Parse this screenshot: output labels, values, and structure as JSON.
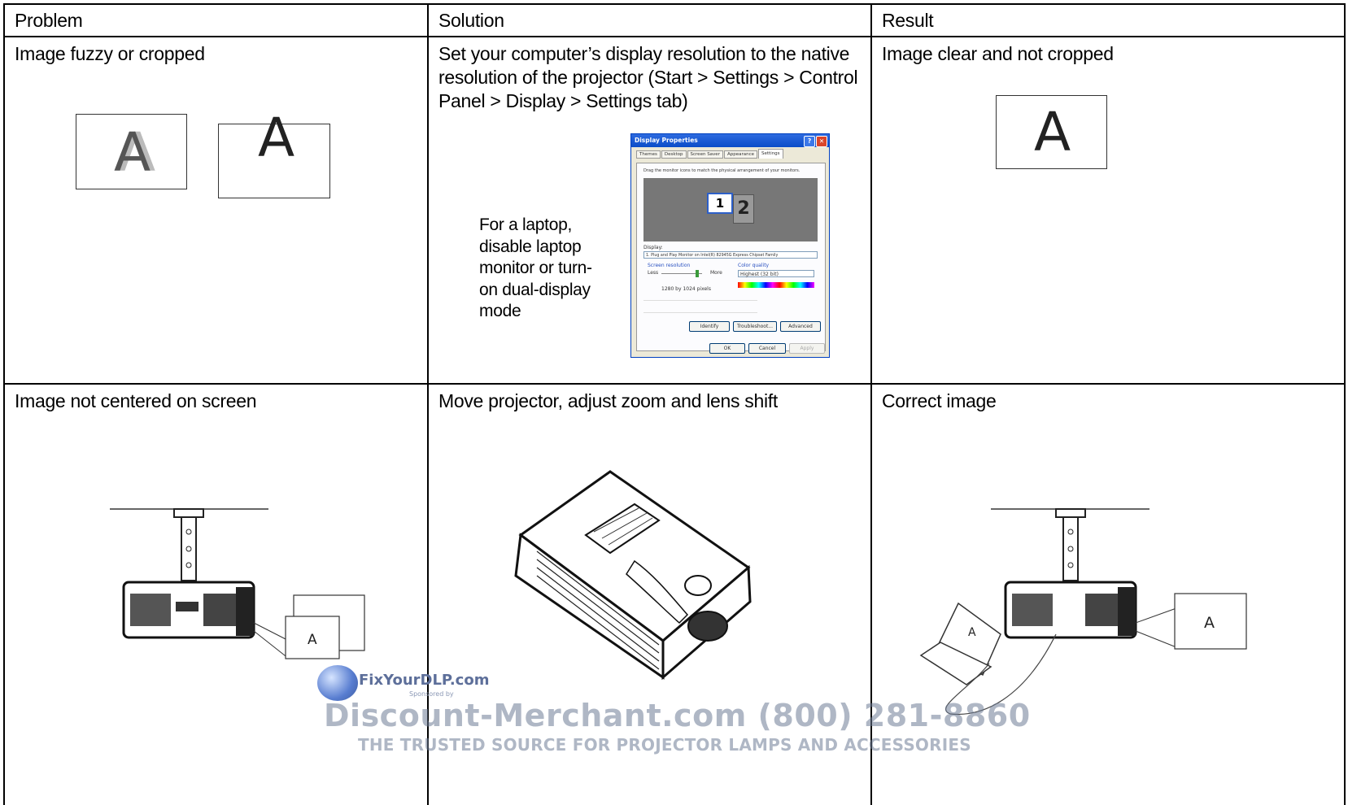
{
  "headers": {
    "problem": "Problem",
    "solution": "Solution",
    "result": "Result"
  },
  "row1": {
    "problem": "Image fuzzy or cropped",
    "solution_lines": [
      "Set your computer’s display resolution to the native",
      "resolution of the projector (Start > Settings > Control",
      "Panel > Display > Settings tab)"
    ],
    "result": "Image clear and not cropped",
    "laptop_note_lines": [
      "For a laptop,",
      "disable laptop",
      "monitor or turn-",
      "on dual-display",
      "mode"
    ],
    "letter": "A"
  },
  "dialog": {
    "title": "Display Properties",
    "tabs": [
      "Themes",
      "Desktop",
      "Screen Saver",
      "Appearance",
      "Settings"
    ],
    "instruction": "Drag the monitor icons to match the physical arrangement of your monitors.",
    "monitor_1": "1",
    "monitor_2": "2",
    "display_label": "Display:",
    "display_value": "1. Plug and Play Monitor on Intel(R) 82945G Express Chipset Family",
    "resolution_label": "Screen resolution",
    "less": "Less",
    "more": "More",
    "resolution_value": "1280 by 1024 pixels",
    "color_label": "Color quality",
    "color_value": "Highest (32 bit)",
    "buttons": [
      "Identify",
      "Troubleshoot...",
      "Advanced"
    ],
    "ok": "OK",
    "cancel": "Cancel",
    "apply": "Apply"
  },
  "row2": {
    "problem": "Image not centered on screen",
    "solution": "Move projector, adjust zoom and lens shift",
    "result": "Correct image",
    "letter": "A"
  },
  "watermark": {
    "site": "FixYourDLP.com",
    "sponsored": "Sponsored by",
    "brand": "Discount-Merchant.com (800) 281-8860",
    "tagline": "THE TRUSTED SOURCE FOR PROJECTOR LAMPS AND ACCESSORIES"
  }
}
